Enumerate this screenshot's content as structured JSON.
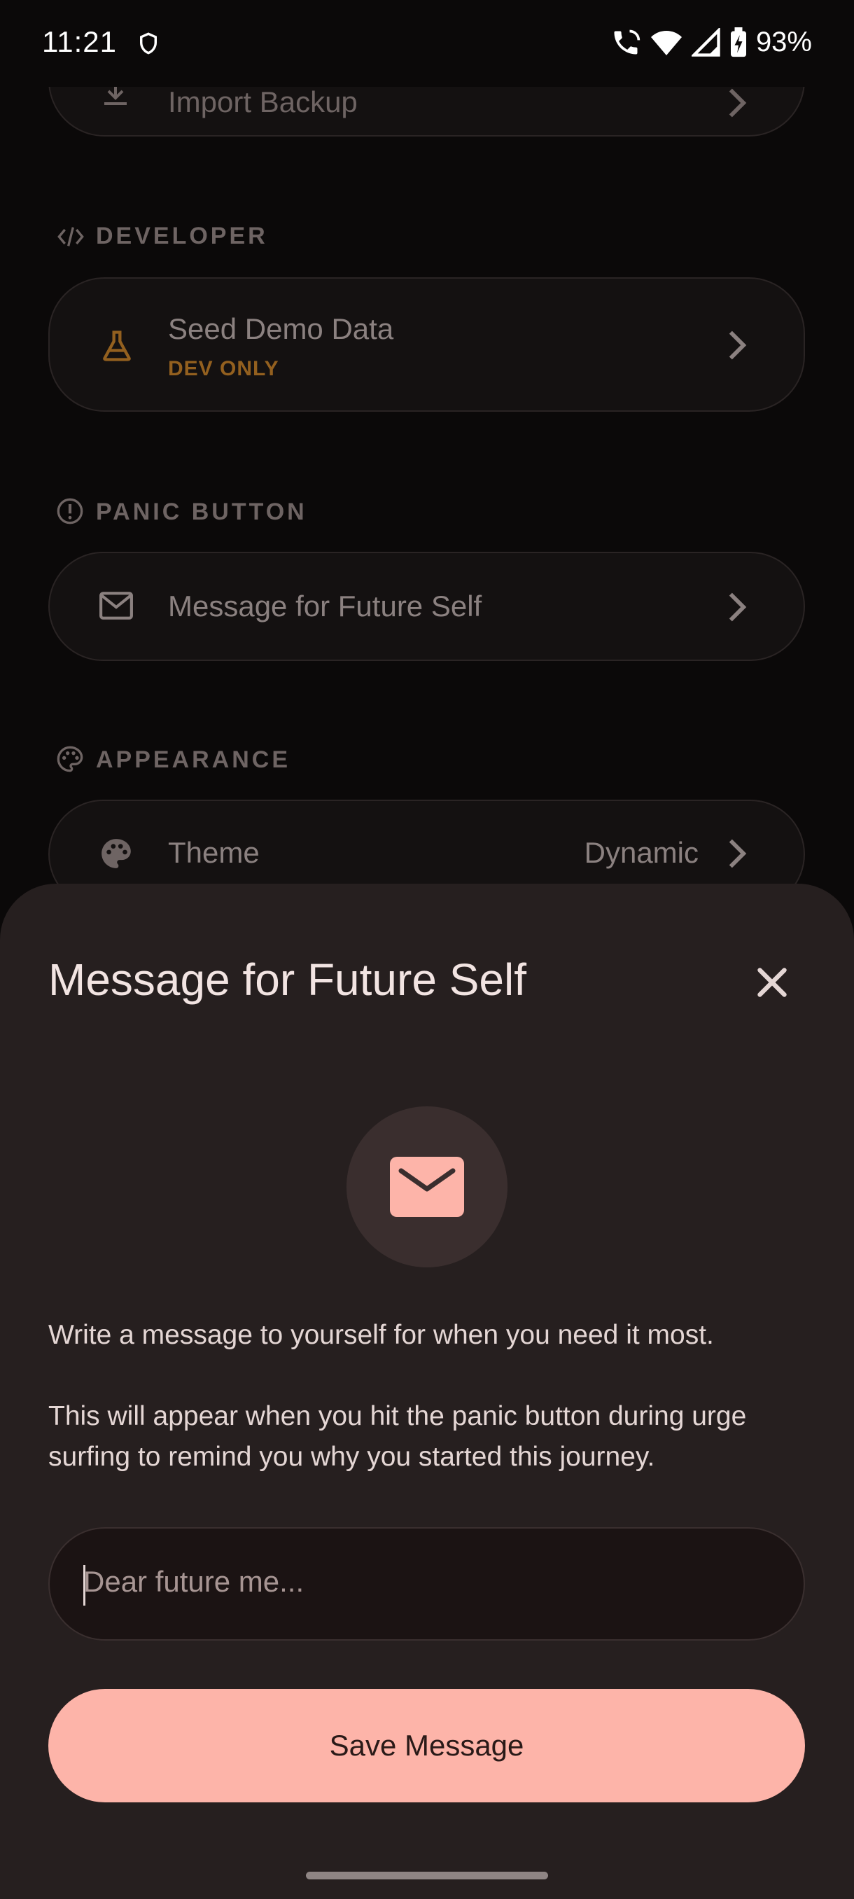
{
  "status_bar": {
    "time": "11:21",
    "battery": "93%"
  },
  "background": {
    "import_backup_label": "Import Backup",
    "developer": {
      "section_label": "DEVELOPER",
      "seed_title": "Seed Demo Data",
      "seed_sub": "DEV ONLY"
    },
    "panic": {
      "section_label": "PANIC BUTTON",
      "message_label": "Message for Future Self"
    },
    "appearance": {
      "section_label": "APPEARANCE",
      "theme_label": "Theme",
      "theme_value": "Dynamic"
    }
  },
  "sheet": {
    "title": "Message for Future Self",
    "description_1": "Write a message to yourself for when you need it most.",
    "description_2": "This will appear when you hit the panic button during urge surfing to remind you why you started this journey.",
    "input_placeholder": "Dear future me...",
    "input_value": "",
    "save_label": "Save Message"
  },
  "icons": {
    "status_shield": "shield-icon",
    "status_call": "wifi-calling-icon",
    "status_wifi": "wifi-icon",
    "status_signal": "signal-icon",
    "status_battery": "battery-charging-icon",
    "import": "import-icon",
    "developer": "code-icon",
    "seed": "flask-icon",
    "panic": "alert-circle-icon",
    "message": "mail-icon",
    "appearance": "palette-icon",
    "theme": "palette-icon",
    "chevron": "chevron-right-icon",
    "close": "close-icon",
    "hero": "mail-icon"
  },
  "colors": {
    "background": "#0b0909",
    "sheet": "#261f1f",
    "accent": "#fdb4a9",
    "dev_only": "#93601f"
  }
}
